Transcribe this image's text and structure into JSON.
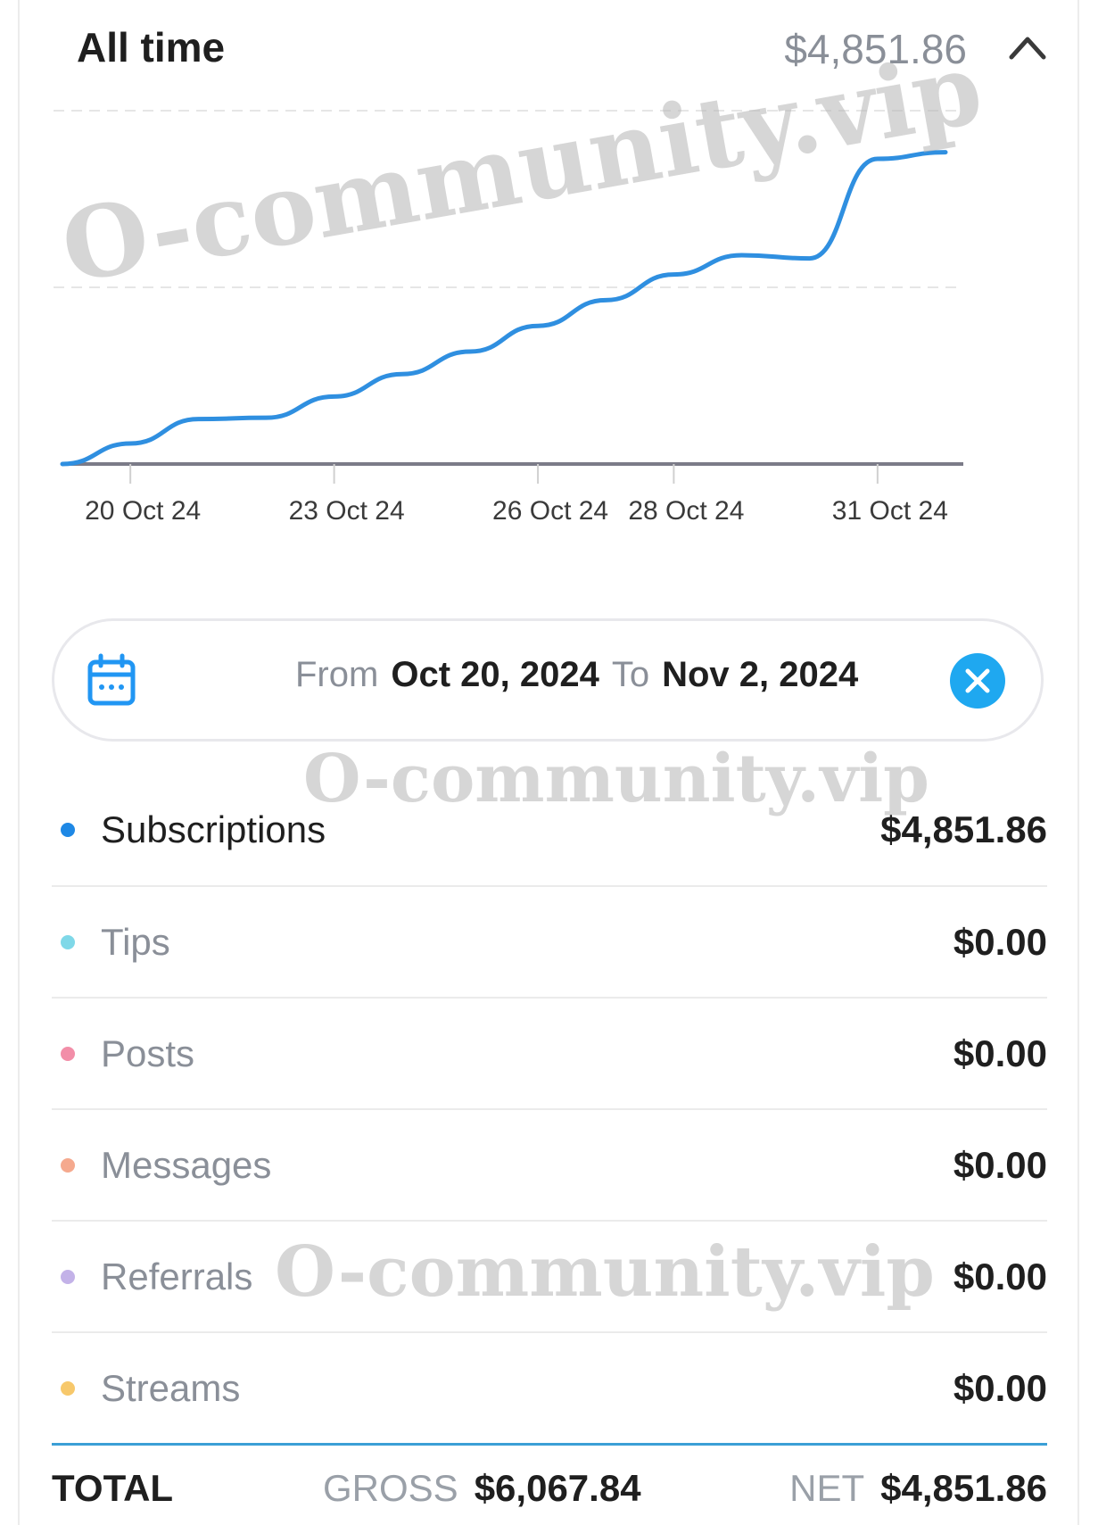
{
  "header": {
    "title": "All time",
    "amount": "$4,851.86"
  },
  "chart_data": {
    "type": "line",
    "title": "",
    "xlabel": "",
    "ylabel": "",
    "x_tick_labels": [
      "20 Oct 24",
      "23 Oct 24",
      "26 Oct 24",
      "28 Oct 24",
      "31 Oct 24"
    ],
    "x": [
      "2024-10-19",
      "2024-10-20",
      "2024-10-21",
      "2024-10-22",
      "2024-10-23",
      "2024-10-24",
      "2024-10-25",
      "2024-10-26",
      "2024-10-27",
      "2024-10-28",
      "2024-10-29",
      "2024-10-30",
      "2024-10-31",
      "2024-11-01"
    ],
    "series": [
      {
        "color": "#2f8fe0",
        "values": [
          0,
          320,
          700,
          720,
          1050,
          1400,
          1750,
          2150,
          2550,
          2950,
          3250,
          3200,
          4750,
          4851.86
        ]
      }
    ],
    "ylim": [
      0,
      5500
    ],
    "grid": true,
    "legend": "none"
  },
  "daterange": {
    "from_label": "From",
    "from_value": "Oct 20, 2024",
    "to_label": "To",
    "to_value": "Nov 2, 2024",
    "icon": "calendar-icon",
    "clear_icon": "close-icon"
  },
  "categories": [
    {
      "label": "Subscriptions",
      "value": "$4,851.86",
      "color": "#1e88e5"
    },
    {
      "label": "Tips",
      "value": "$0.00",
      "color": "#7fd8e8"
    },
    {
      "label": "Posts",
      "value": "$0.00",
      "color": "#f28ea8"
    },
    {
      "label": "Messages",
      "value": "$0.00",
      "color": "#f5a98e"
    },
    {
      "label": "Referrals",
      "value": "$0.00",
      "color": "#c3b2e8"
    },
    {
      "label": "Streams",
      "value": "$0.00",
      "color": "#f7c86b"
    }
  ],
  "total": {
    "label": "TOTAL",
    "gross_label": "GROSS",
    "gross_value": "$6,067.84",
    "net_label": "NET",
    "net_value": "$4,851.86"
  },
  "watermark": "O-community.vip"
}
